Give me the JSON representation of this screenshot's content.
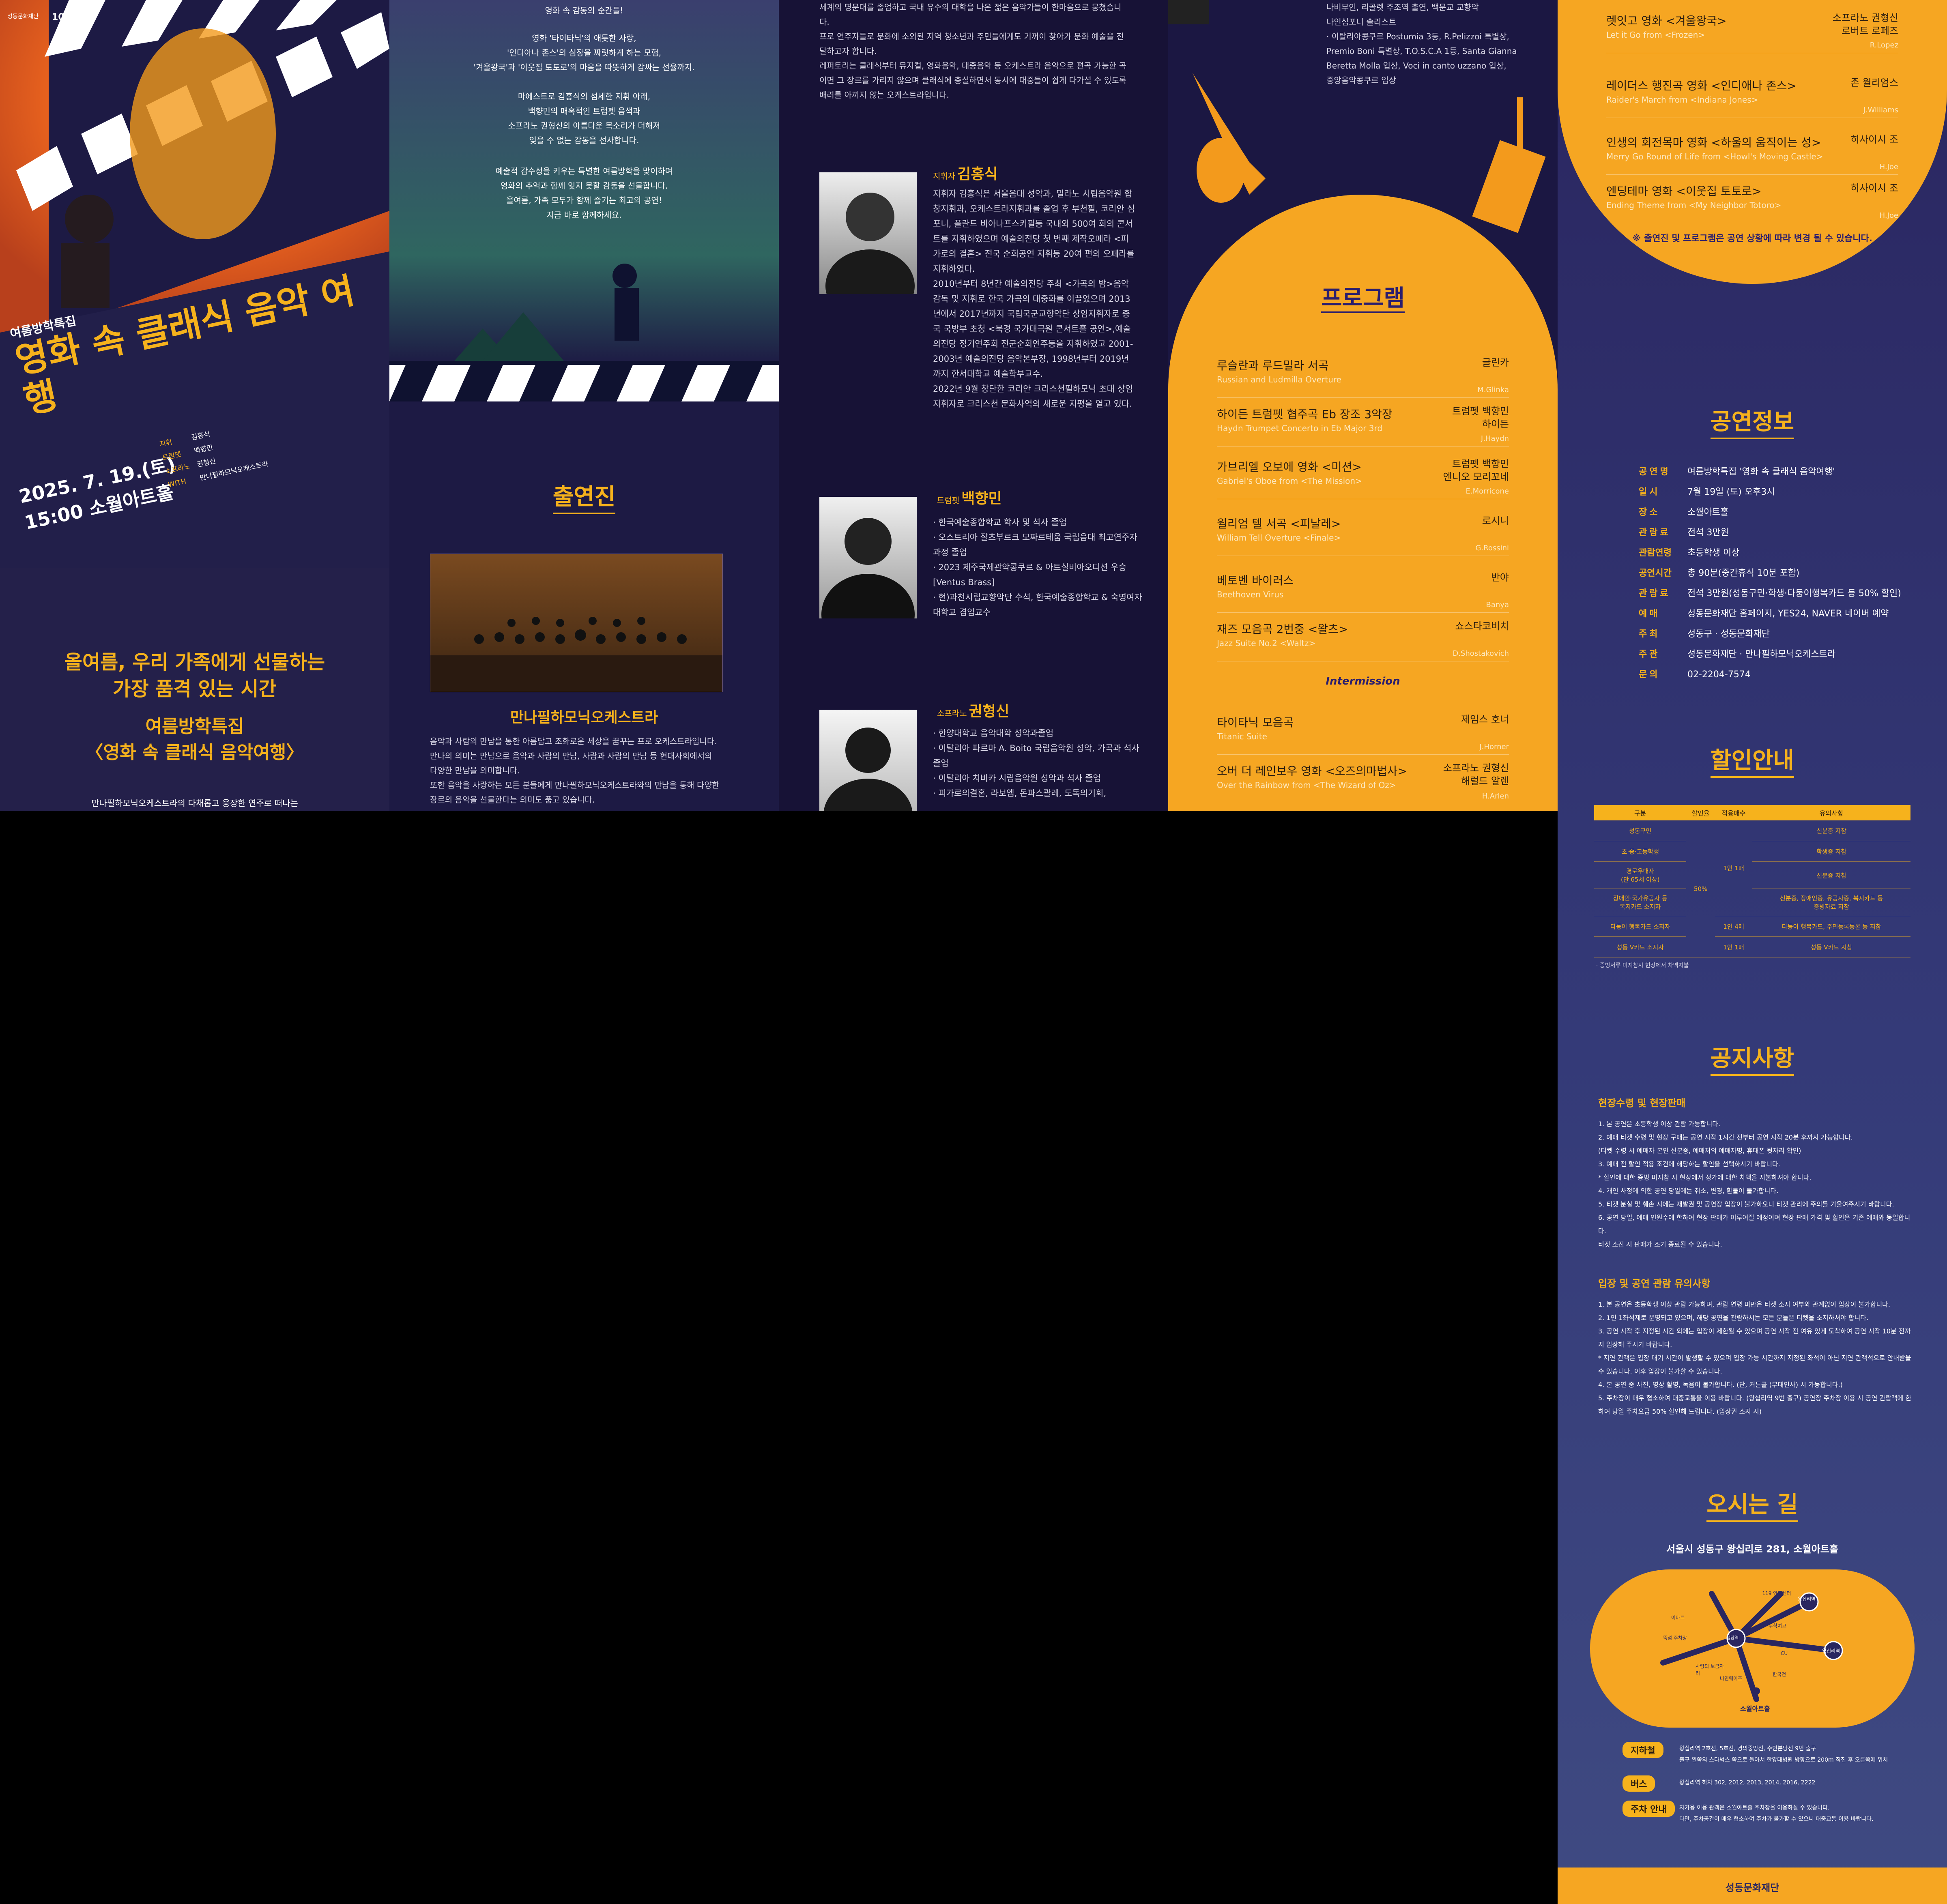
{
  "poster": {
    "org_logo": "성동문화재단",
    "badge": "10th",
    "series": "여름방학특집",
    "title": "영화 속 클래식 음악 여행",
    "date": "2025. 7. 19.(토)",
    "time_venue": "15:00 소월아트홀",
    "credits": [
      {
        "role": "지휘",
        "name": "김홍식"
      },
      {
        "role": "트럼펫",
        "name": "백향민"
      },
      {
        "role": "소프라노",
        "name": "권형신"
      },
      {
        "role": "WITH",
        "name": "만나필하모닉오케스트라"
      }
    ],
    "tagline_1": "올여름, 우리 가족에게 선물하는",
    "tagline_2": "가장 품격 있는 시간",
    "subtitle_1": "여름방학특집",
    "subtitle_2": "〈영화 속 클래식 음악여행〉",
    "intro": "만나필하모닉오케스트라의 다채롭고 웅장한 연주로 떠나는"
  },
  "intro_panel": {
    "p1": "영화 속 감동의 순간들!",
    "p2": "영화 '타이타닉'의 애틋한 사랑,\n'인디아나 존스'의 심장을 짜릿하게 하는 모험,\n'겨울왕국'과 '이웃집 토토로'의 마음을 따뜻하게 감싸는 선율까지.",
    "p3": "마에스트로 김홍식의 섬세한 지휘 아래,\n백향민의 매혹적인 트럼펫 음색과\n소프라노 권형신의 아름다운 목소리가 더해져\n잊을 수 없는 감동을 선사합니다.",
    "p4": "예술적 감수성을 키우는 특별한 여름방학을 맞이하여\n영화의 추억과 함께 잊지 못할 감동을 선물합니다.\n올여름, 가족 모두가 함께 즐기는 최고의 공연!\n지금 바로 함께하세요.",
    "performers_title": "출연진",
    "orchestra_name": "만나필하모닉오케스트라",
    "orchestra_desc": "음악과 사람의 만남을 통한 아름답고 조화로운 세상을 꿈꾸는 프로 오케스트라입니다.\n만나의 의미는 만남으로 음악과 사람의 만남, 사람과 사람의 만남 등 현대사회에서의 다양한 만남을 의미합니다.\n또한 음악을 사랑하는 모든 분들에게 만나필하모닉오케스트라와의 만남을 통해 다양한 장르의 음악을 선물한다는 의미도 품고 있습니다."
  },
  "artists": {
    "top_text": "세계의 명문대를 졸업하고 국내 유수의 대학을 나온 젊은 음악가들이 한마음으로 뭉쳤습니다.\n프로 연주자들로 문화에 소외된 지역 청소년과 주민들에게도 기꺼이 찾아가 문화 예술을 전달하고자 합니다.\n레퍼토리는 클래식부터 뮤지컬, 영화음악, 대중음악 등 오케스트라 음악으로 편곡 가능한 곡이면 그 장르를 가리지 않으며 클래식에 충실하면서 동시에 대중들이 쉽게 다가설 수 있도록 배려를 아끼지 않는 오케스트라입니다.",
    "conductor_role": "지휘자",
    "conductor_name": "김홍식",
    "conductor_bio": "지휘자 김홍식은 서울음대 성악과, 밀라노 시립음악원 합창지휘과, 오케스트라지휘과를 졸업 후 부천필, 코리안 심포니, 폴란드 비아나프스키필등 국내외 500여 회의 콘서트를 지휘하였으며 예술의전당 첫 번째 제작오페라 <피가로의 결혼> 전국 순회공연 지휘등 20여 편의 오페라를 지휘하였다.\n2010년부터 8년간 예술의전당 주최 <가곡의 밤>음악감독 및 지휘로 한국 가곡의 대중화를 이끌었으며 2013년에서 2017년까지 국립국군교향악단 상임지휘자로 중국 국방부 초청 <북경 국가대극원 콘서트홀 공연>,예술의전당 정기연주회 전군순회연주등을 지휘하였고 2001-2003년 예술의전당 음악본부장, 1998년부터 2019년까지 한서대학교 예술학부교수.\n2022년 9월 창단한 코리안 크리스천필하모닉 초대 상임 지휘자로 크리스천 문화사역의 새로운 지평을 열고 있다.",
    "trumpet_role": "트럼펫",
    "trumpet_name": "백향민",
    "trumpet_bio": "· 한국예술종합학교 학사 및 석사 졸업\n· 오스트리아 잘츠부르크 모짜르테움 국립음대 최고연주자과정 졸업\n· 2023 제주국제관악콩쿠르 & 아트실비아오디션 우승 [Ventus Brass]\n· 현)과천시립교향악단 수석, 한국예술종합학교 & 숙명여자대학교 겸임교수",
    "soprano_role": "소프라노",
    "soprano_name": "권형신",
    "soprano_bio": "· 한양대학교 음악대학 성악과졸업\n· 이탈리아 파르마 A. Boito 국립음악원 성악, 가곡과 석사 졸업\n· 이탈리아 치비카 시립음악원 성악과 석사 졸업\n· 피가로의결혼, 라보엠, 돈파스콸레, 도독의기회,",
    "soprano_cont": "나비부인, 리골렛 주조역 출연, 백문교 교향악\n나인심포니 솔리스트\n· 이탈리아콩쿠르 Postumia 3등, R.Pelizzoi 특별상,\nPremio Boni 특별상, T.O.S.C.A 1등, Santa Gianna\nBeretta Molla 입상, Voci in canto uzzano 입상,\n중앙음악콩쿠르 입상"
  },
  "program": {
    "title": "프로그램",
    "items": [
      {
        "kr": "루슬란과 루드밀라 서곡",
        "en": "Russian and Ludmilla Overture",
        "perf": "글린카",
        "comp": "M.Glinka"
      },
      {
        "kr": "하이든 트럼펫 협주곡 Eb 장조 3악장",
        "en": "Haydn Trumpet Concerto in Eb Major 3rd",
        "perf": "트럼펫 백향민\n하이든",
        "comp": "J.Haydn"
      },
      {
        "kr": "가브리엘 오보에 영화 <미션>",
        "en": "Gabriel's Oboe from <The Mission>",
        "perf": "트럼펫 백향민\n엔니오 모리꼬네",
        "comp": "E.Morricone"
      },
      {
        "kr": "윌리엄 텔 서곡 <피날레>",
        "en": "William Tell Overture <Finale>",
        "perf": "로시니",
        "comp": "G.Rossini"
      },
      {
        "kr": "베토벤 바이러스",
        "en": "Beethoven Virus",
        "perf": "반야",
        "comp": "Banya"
      },
      {
        "kr": "재즈 모음곡 2번중 <왈츠>",
        "en": "Jazz Suite No.2 <Waltz>",
        "perf": "쇼스타코비치",
        "comp": "D.Shostakovich"
      }
    ],
    "intermission": "Intermission",
    "items2": [
      {
        "kr": "타이타닉 모음곡",
        "en": "Titanic Suite",
        "perf": "제임스 호너",
        "comp": "J.Horner"
      },
      {
        "kr": "오버 더 레인보우 영화 <오즈의마법사>",
        "en": "Over the Rainbow from <The Wizard of Oz>",
        "perf": "소프라노 권형신\n해럴드 알렌",
        "comp": "H.Arlen"
      },
      {
        "kr": "렛잇고 영화 <겨울왕국>",
        "en": "Let it Go from <Frozen>",
        "perf": "소프라노 권형신\n로버트 로페즈",
        "comp": "R.Lopez"
      },
      {
        "kr": "레이더스 행진곡 영화 <인디애나 존스>",
        "en": "Raider's March from <Indiana Jones>",
        "perf": "존 윌리엄스",
        "comp": "J.Williams"
      },
      {
        "kr": "인생의 회전목마 영화 <하울의 움직이는 성>",
        "en": "Merry Go Round of Life from <Howl's Moving Castle>",
        "perf": "히사이시 조",
        "comp": "H.Joe"
      },
      {
        "kr": "엔딩테마 영화 <이웃집 토토로>",
        "en": "Ending Theme from <My Neighbor Totoro>",
        "perf": "히사이시 조",
        "comp": "H.Joe"
      }
    ],
    "note": "※ 출연진 및 프로그램은 공연 상황에 따라 변경 될 수 있습니다."
  },
  "info": {
    "title": "공연정보",
    "rows": [
      {
        "k": "공연명",
        "v": "여름방학특집 '영화 속 클래식 음악여행'"
      },
      {
        "k": "일시",
        "v": "7월 19일 (토) 오후3시"
      },
      {
        "k": "장소",
        "v": "소월아트홀"
      },
      {
        "k": "관람료",
        "v": "전석 3만원"
      },
      {
        "k": "관람연령",
        "v": "초등학생 이상"
      },
      {
        "k": "공연시간",
        "v": "총 90분(중간휴식 10분 포함)"
      },
      {
        "k": "관람료",
        "v": "전석 3만원(성동구민·학생·다둥이행복카드 등 50% 할인)"
      },
      {
        "k": "예매",
        "v": "성동문화재단 홈페이지, YES24, NAVER 네이버 예약"
      },
      {
        "k": "주최",
        "v": "성동구 · 성동문화재단"
      },
      {
        "k": "주관",
        "v": "성동문화재단 · 만나필하모닉오케스트라"
      },
      {
        "k": "문의",
        "v": "02-2204-7574"
      }
    ]
  },
  "discount": {
    "title": "할인안내",
    "headers": [
      "구분",
      "할인율",
      "적용매수",
      "유의사항"
    ],
    "rows": [
      [
        "성동구민",
        "",
        "",
        "신분증 지참"
      ],
      [
        "초·중·고등학생",
        "",
        "",
        "학생증 지참"
      ],
      [
        "경로우대자\n(만 65세 이상)",
        "50%",
        "1인 1매",
        "신분증 지참"
      ],
      [
        "장애인·국가유공자 등\n복지카드 소지자",
        "",
        "",
        "신분증, 장애인증, 유공자증, 복지카드 등\n증빙자료 지참"
      ],
      [
        "다둥이 행복카드 소지자",
        "",
        "1인 4매",
        "다둥이 행복카드, 주민등록등본 등 지참"
      ],
      [
        "성동 V카드 소지자",
        "",
        "1인 1매",
        "성동 V카드 지참"
      ]
    ],
    "footnote": "· 증빙서류 미지참시 현장에서 차액지불"
  },
  "notice": {
    "title": "공지사항",
    "h1": "현장수령 및 현장판매",
    "l1": "1. 본 공연은 초등학생 이상 관람 가능합니다.\n2. 예매 티켓 수령 및 현장 구매는 공연 시작 1시간 전부터 공연 시작 20분 후까지 가능합니다.\n   (티켓 수령 시 예매자 본인 신분증, 예매처의 예매자명, 휴대폰 뒷자리 확인)\n3. 예매 전 할인 적용 조건에 해당하는 할인을 선택하시기 바랍니다.\n   * 할인에 대한 증빙 미지참 시 현장에서 정가에 대한 차액을 지불하셔야 합니다.\n4. 개인 사정에 의한 공연 당일에는 취소, 변경, 환불이 불가합니다.\n5. 티켓 분실 및 훼손 시에는 재발권 및 공연장 입장이 불가하오니 티켓 관리에 주의를 기울여주시기 바랍니다.\n6. 공연 당일, 예매 인원수에 한하여 현장 판매가 이루어질 예정이며 현장 판매 가격 및 할인은 기존 예매와 동일합니다.\n   티켓 소진 시 판매가 조기 종료될 수 있습니다.",
    "h2": "입장 및 공연 관람 유의사항",
    "l2": "1. 본 공연은 초등학생 이상 관람 가능하며, 관람 연령 미만은 티켓 소지 여부와 관계없이 입장이 불가합니다.\n2. 1인 1좌석제로 운영되고 있으며, 해당 공연을 관람하시는 모든 분들은 티켓을 소지하셔야 합니다.\n3. 공연 시작 후 지정된 시간 외에는 입장이 제한될 수 있으며 공연 시작 전 여유 있게 도착하여 공연 시작 10분 전까지 입장해 주시기 바랍니다.\n   * 지연 관객은 입장 대기 시간이 발생할 수 있으며 입장 가능 시간까지 지정된 좌석이 아닌 지연 관객석으로 안내받을 수 있습니다. 이후 입장이 불가할 수 있습니다.\n4. 본 공연 중 사진, 영상 촬영, 녹음이 불가합니다. (단, 커튼콜 (무대인사) 시 가능합니다.)\n5. 주차장이 매우 협소하여 대중교통을 이용 바랍니다. (왕십리역 9번 출구) 공연장 주차장 이용 시 공연 관람객에 한하여 당일 주차요금 50% 할인해 드립니다. (입장권 소지 시)"
  },
  "location": {
    "title": "오시는 길",
    "address": "서울시 성동구 왕십리로 281, 소월아트홀",
    "map_labels": [
      "119 안전센터",
      "왕십리역",
      "왕십리역",
      "이마트",
      "뚝섬 주차장",
      "무학여고",
      "CU",
      "행당역",
      "사랑의 보금자리",
      "나인웨이즈",
      "한국전",
      "소월아트홀"
    ],
    "subway_tag": "지하철",
    "subway": "왕십리역 2호선, 5호선, 경의중앙선, 수인분당선 9번 출구\n출구 왼쪽의 스타벅스 쪽으로 돌아서 한양대병원 방향으로 200m 직진 후 오른쪽에 위치",
    "bus_tag": "버스",
    "bus": "왕십리역 하차 302, 2012, 2013, 2014, 2016, 2222",
    "parking_tag": "주차 안내",
    "parking": "자가용 이용 관객은 소월아트홀 주차장을 이용하실 수 있습니다.\n다만, 주차공간이 매우 협소하여 주차가 불가할 수 있으니 대중교통 이용 바랍니다."
  },
  "footer_logo": "성동문화재단",
  "colors": {
    "accent": "#f6b21c",
    "navy": "#1d1a44",
    "orange": "#f39a1c"
  }
}
